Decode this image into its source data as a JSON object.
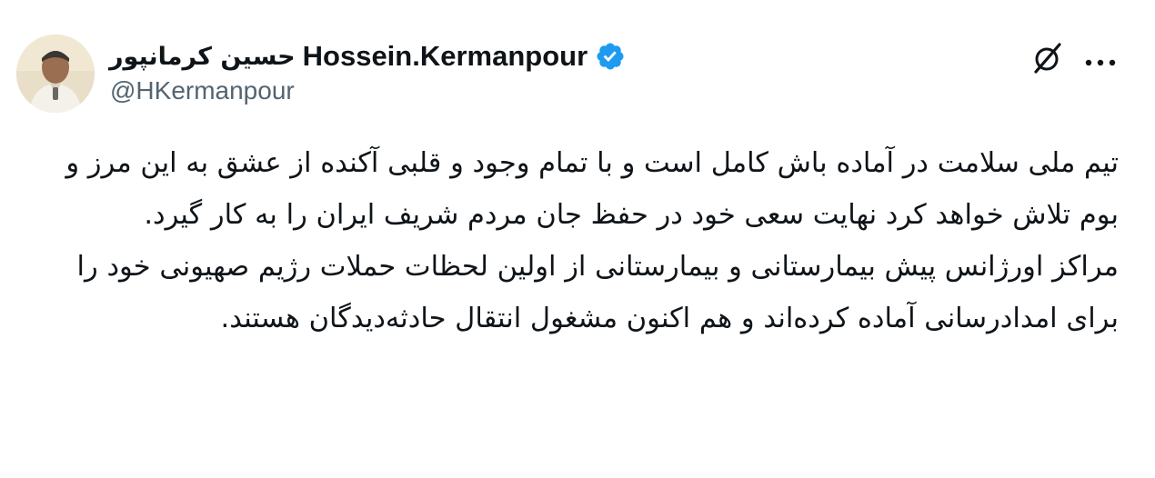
{
  "author": {
    "name_fa": "حسین کرمانپور",
    "name_en": "Hossein.Kermanpour",
    "handle": "@HKermanpour",
    "verified": true,
    "verified_color": "#1d9bf0"
  },
  "actions": {
    "grok_icon": "grok-icon",
    "more_icon": "more-icon"
  },
  "tweet": {
    "paragraph1": "تیم ملی سلامت  در آماده باش کامل است و با تمام وجود و قلبی آکنده از عشق به این مرز و بوم تلاش خواهد کرد نهایت سعی خود در حفظ جان مردم شریف ایران را به کار گیرد.",
    "paragraph2": "مراکز اورژانس پیش بیمارستانی و بیمارستانی از اولین لحظات حملات رژیم صهیونی خود را برای امدادرسانی آماده کرده‌اند و هم اکنون مشغول انتقال حادثه‌دیدگان هستند."
  }
}
